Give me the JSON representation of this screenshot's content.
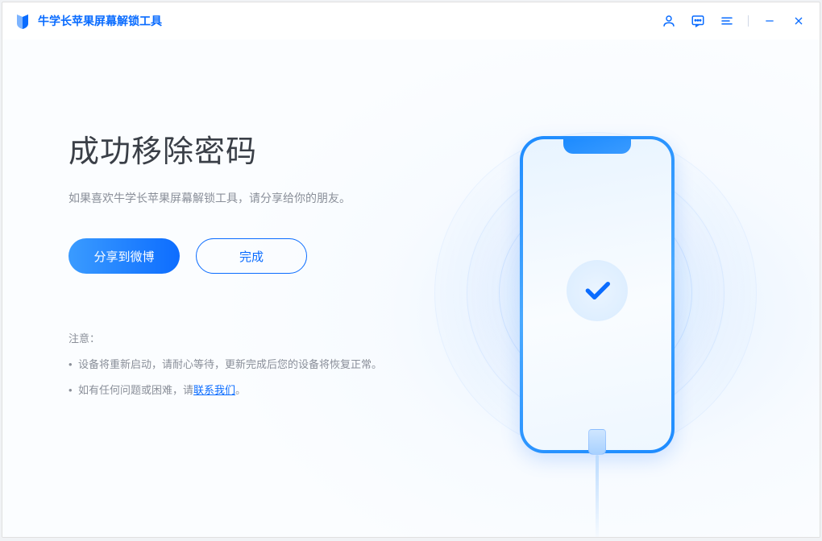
{
  "app": {
    "title": "牛学长苹果屏幕解锁工具"
  },
  "main": {
    "heading": "成功移除密码",
    "subheading": "如果喜欢牛学长苹果屏幕解锁工具，请分享给你的朋友。",
    "share_button": "分享到微博",
    "done_button": "完成"
  },
  "notice": {
    "title": "注意：",
    "item1": "设备将重新启动，请耐心等待，更新完成后您的设备将恢复正常。",
    "item2_prefix": "如有任何问题或困难，请",
    "item2_link": "联系我们",
    "item2_suffix": "。"
  }
}
